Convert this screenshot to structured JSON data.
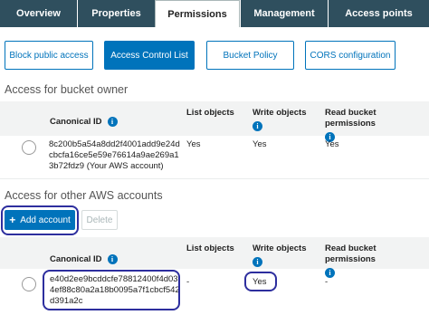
{
  "tabs": {
    "overview": "Overview",
    "properties": "Properties",
    "permissions": "Permissions",
    "management": "Management",
    "access_points": "Access points"
  },
  "subtabs": {
    "block_public_access": "Block public access",
    "acl": "Access Control List",
    "bucket_policy": "Bucket Policy",
    "cors": "CORS configuration"
  },
  "owner_section": {
    "title": "Access for bucket owner",
    "headers": {
      "canonical_id": "Canonical ID",
      "list_objects": "List objects",
      "write_objects": "Write objects",
      "read_bucket_permissions": "Read bucket permissions"
    },
    "row": {
      "canonical_id": "8c200b5a54a8dd2f4001add9e24dcbcfa16ce5e59e76614a9ae269a13b72fdz9 (Your AWS account)",
      "list_objects": "Yes",
      "write_objects": "Yes",
      "read_bucket_permissions": "Yes"
    }
  },
  "other_section": {
    "title": "Access for other AWS accounts",
    "add_account": "Add account",
    "delete": "Delete",
    "headers": {
      "canonical_id": "Canonical ID",
      "list_objects": "List objects",
      "write_objects": "Write objects",
      "read_bucket_permissions": "Read bucket permissions"
    },
    "row": {
      "canonical_id": "e40d2ee9bcddcfe78812400f4d034ef88c80a2a18b0095a7f1cbcf542d391a2c",
      "list_objects": "-",
      "write_objects": "Yes",
      "read_bucket_permissions": "-"
    }
  },
  "colors": {
    "tab_bg": "#2f4f5e",
    "accent": "#0073bb",
    "highlight": "#2d2e9e",
    "table_header_bg": "#f2f3f3"
  }
}
